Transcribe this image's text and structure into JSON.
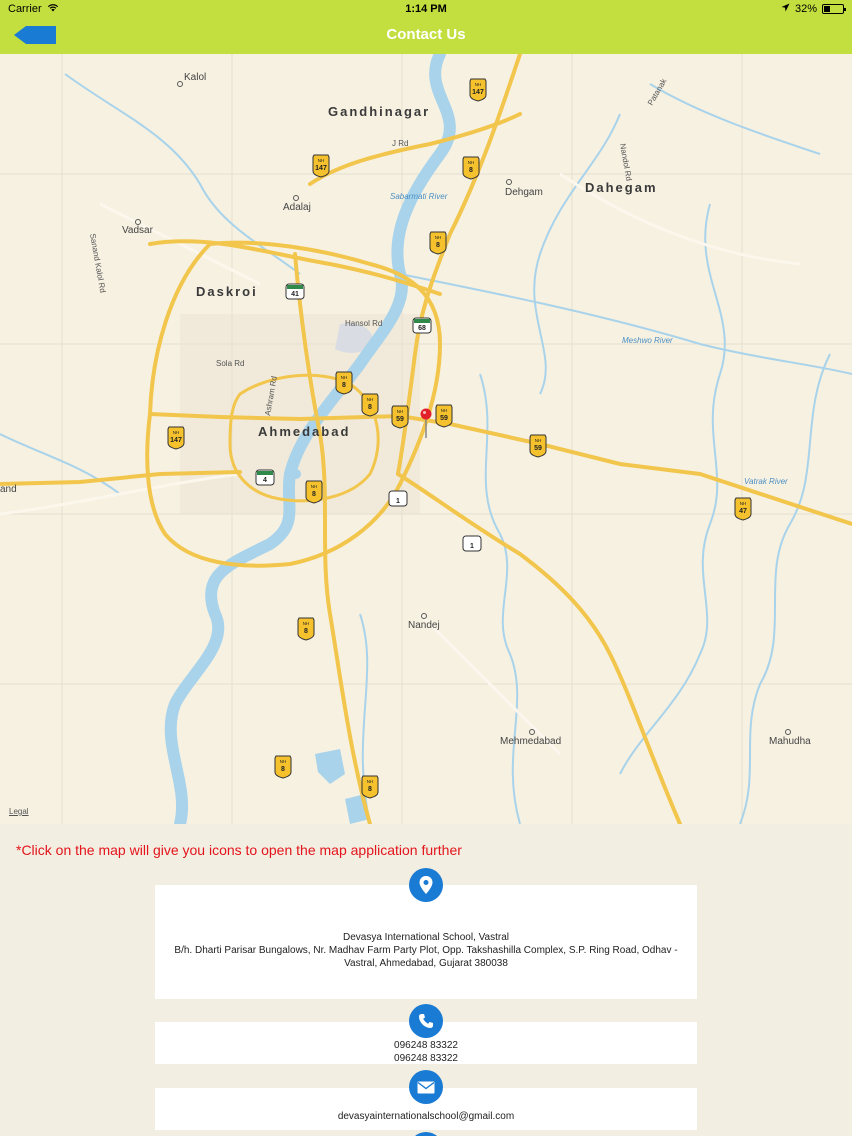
{
  "status_bar": {
    "carrier": "Carrier",
    "time": "1:14 PM",
    "battery": "32%",
    "battery_level": 0.32
  },
  "nav": {
    "title": "Contact Us",
    "back_icon": "back-arrow-icon"
  },
  "map": {
    "cities": [
      "Gandhinagar",
      "Dahegam",
      "Daskroi",
      "Ahmedabad"
    ],
    "towns": [
      "Kalol",
      "Adalaj",
      "Vadsar",
      "Dehgam",
      "Nandej",
      "Mehmedabad",
      "Mahudha",
      "and"
    ],
    "rivers": [
      "Sabarmati River",
      "Meshwo River",
      "Vatrak River"
    ],
    "roads": [
      "J Rd",
      "Hansol Rd",
      "Sola Rd",
      "Ashram Rd",
      "Sanand Kalol Rd",
      "Nandol Rd",
      "Patanak"
    ],
    "highway_shields": [
      "147",
      "147",
      "8",
      "8",
      "8",
      "8",
      "8",
      "8",
      "8",
      "59",
      "59",
      "59",
      "47",
      "147",
      "8",
      "59"
    ],
    "route_shields": [
      "41",
      "68",
      "4",
      "1",
      "1"
    ],
    "shield_prefix": "NH",
    "legal": "Legal",
    "pin_icon": "location-pin-icon"
  },
  "info": {
    "note": "*Click on the map will give you icons to open the map application further",
    "address_line1": "Devasya International School, Vastral",
    "address_line2": "B/h. Dharti Parisar Bungalows, Nr. Madhav Farm Party Plot, Opp. Takshashilla Complex, S.P. Ring Road, Odhav -",
    "address_line3": "Vastral, Ahmedabad, Gujarat 380038",
    "phone1": "096248 83322",
    "phone2": "096248 83322",
    "email": "devasyainternationalschool@gmail.com"
  },
  "colors": {
    "accent": "#c3de3f",
    "icon_blue": "#1a7bd4",
    "note_red": "#e3141b",
    "water": "#a8d3ea",
    "highway": "#f2c64c"
  }
}
